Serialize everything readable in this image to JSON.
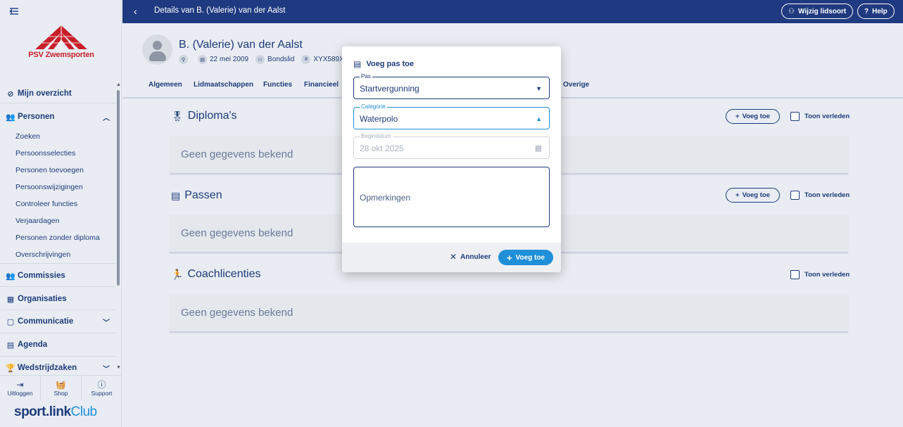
{
  "sidebar": {
    "logo_text": "PSV Zwemsporten",
    "items": [
      {
        "label": "Mijn overzicht",
        "icon": "check-circle-icon"
      },
      {
        "label": "Personen",
        "icon": "people-icon"
      },
      {
        "label": "Commissies",
        "icon": "people-icon"
      },
      {
        "label": "Organisaties",
        "icon": "building-icon"
      },
      {
        "label": "Communicatie",
        "icon": "chat-icon"
      },
      {
        "label": "Agenda",
        "icon": "calendar-icon"
      },
      {
        "label": "Wedstrijdzaken",
        "icon": "trophy-icon"
      }
    ],
    "subitems": [
      "Zoeken",
      "Persoonsselecties",
      "Personen toevoegen",
      "Persoonswijzigingen",
      "Controleer functies",
      "Verjaardagen",
      "Personen zonder diploma",
      "Overschrijvingen"
    ],
    "bottom": [
      {
        "label": "Uitloggen",
        "icon": "logout-icon"
      },
      {
        "label": "Shop",
        "icon": "basket-icon"
      },
      {
        "label": "Support",
        "icon": "question-icon"
      }
    ],
    "brand_main": "sport.link",
    "brand_club": "Club"
  },
  "topbar": {
    "title": "Details van B. (Valerie) van der Aalst",
    "wijzig_label": "Wijzig lidsoort",
    "help_label": "Help"
  },
  "person": {
    "name": "B. (Valerie) van der Aalst",
    "birthdate": "22 mei 2009",
    "member_type": "Bondslid",
    "member_id": "XYX589X"
  },
  "tabs": [
    "Algemeen",
    "Lidmaatschappen",
    "Functies",
    "Financieel",
    "Overige"
  ],
  "sections": {
    "diplomas": {
      "title": "Diploma's",
      "empty": "Geen gegevens bekend",
      "add": "Voeg toe",
      "toggle": "Toon verleden"
    },
    "passen": {
      "title": "Passen",
      "empty": "Geen gegevens bekend",
      "add": "Voeg toe",
      "toggle": "Toon verleden"
    },
    "coach": {
      "title": "Coachlicenties",
      "empty": "Geen gegevens bekend",
      "toggle": "Toon verleden"
    }
  },
  "modal": {
    "title": "Voeg pas toe",
    "pas_label": "Pas",
    "pas_value": "Startvergunning",
    "categorie_label": "Categorie",
    "categorie_value": "Waterpolo",
    "begindatum_label": "Begindatum",
    "begindatum_value": "28 okt 2025",
    "opmerkingen_placeholder": "Opmerkingen",
    "cancel_label": "Annuleer",
    "confirm_label": "Voeg toe"
  },
  "colors": {
    "primary": "#1f3a80",
    "accent": "#1f8fd8",
    "brand_red": "#c8202a"
  }
}
